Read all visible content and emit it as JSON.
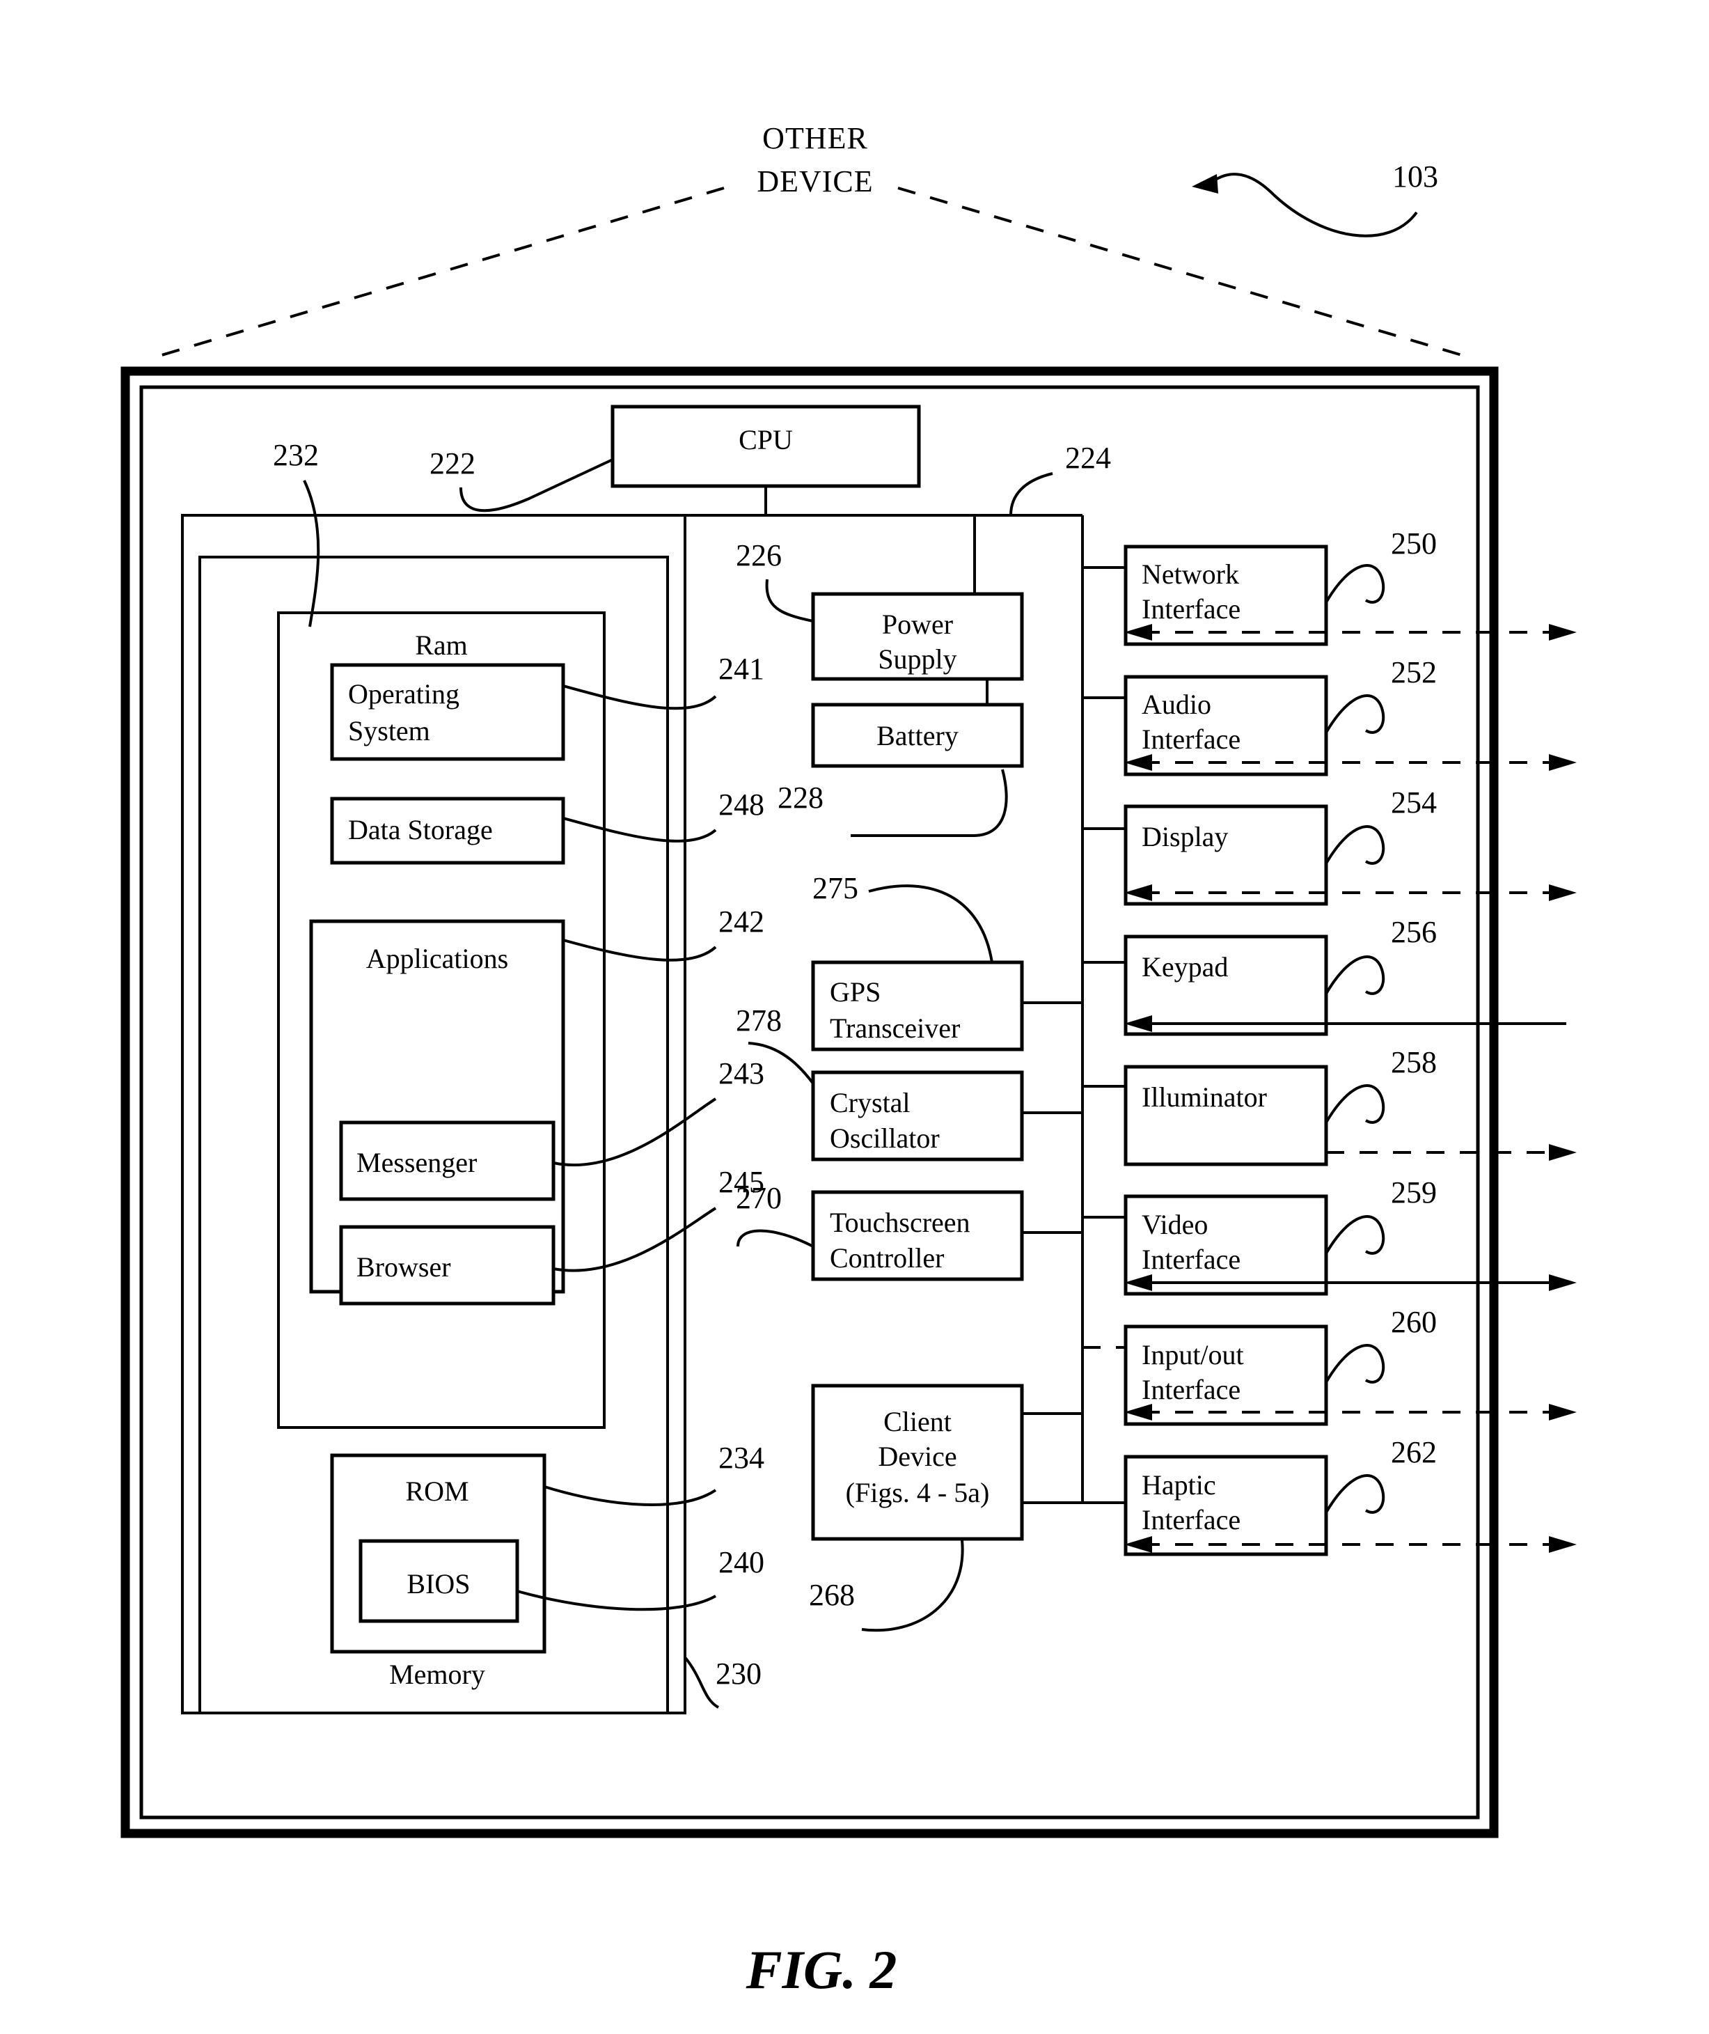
{
  "figure": {
    "caption": "FIG. 2",
    "callout_top": "OTHER DEVICE",
    "callout_top_line1": "OTHER",
    "callout_top_line2": "DEVICE",
    "figure_ref": "103"
  },
  "blocks": {
    "cpu": {
      "label": "CPU",
      "ref": "222"
    },
    "memory": {
      "label": "Memory",
      "ref": "230"
    },
    "memory_inner_ref": "232",
    "ram": {
      "label": "Ram",
      "ref": "234"
    },
    "operating_system": {
      "label_line1": "Operating",
      "label_line2": "System",
      "ref": "241"
    },
    "data_storage": {
      "label": "Data Storage",
      "ref": "248"
    },
    "applications": {
      "label": "Applications",
      "ref": "242"
    },
    "messenger": {
      "label": "Messenger",
      "ref": "243"
    },
    "browser": {
      "label": "Browser",
      "ref": "245"
    },
    "rom": {
      "label": "ROM",
      "ref": "234"
    },
    "bios": {
      "label": "BIOS",
      "ref": "240"
    },
    "power_supply": {
      "label_line1": "Power",
      "label_line2": "Supply",
      "ref": "226"
    },
    "battery": {
      "label": "Battery",
      "ref": "228"
    },
    "gps_transceiver": {
      "label_line1": "GPS",
      "label_line2": "Transceiver",
      "ref": "275"
    },
    "crystal_oscillator": {
      "label_line1": "Crystal",
      "label_line2": "Oscillator",
      "ref": "278"
    },
    "touchscreen_controller": {
      "label_line1": "Touchscreen",
      "label_line2": "Controller",
      "ref": "270"
    },
    "client_device": {
      "label_line1": "Client",
      "label_line2": "Device",
      "label_line3": "(Figs. 4 - 5a)",
      "ref": "268"
    },
    "network_interface": {
      "label_line1": "Network",
      "label_line2": "Interface",
      "ref": "250"
    },
    "audio_interface": {
      "label_line1": "Audio",
      "label_line2": "Interface",
      "ref": "252"
    },
    "display": {
      "label": "Display",
      "ref": "254"
    },
    "keypad": {
      "label": "Keypad",
      "ref": "256"
    },
    "illuminator": {
      "label": "Illuminator",
      "ref": "258"
    },
    "video_interface": {
      "label_line1": "Video",
      "label_line2": "Interface",
      "ref": "259"
    },
    "input_out_interface": {
      "label_line1": "Input/out",
      "label_line2": "Interface",
      "ref": "260"
    },
    "haptic_interface": {
      "label_line1": "Haptic",
      "label_line2": "Interface",
      "ref": "262"
    }
  },
  "bus_ref": "224",
  "reference_numerals": [
    "103",
    "222",
    "224",
    "226",
    "228",
    "230",
    "232",
    "234",
    "240",
    "241",
    "242",
    "243",
    "245",
    "248",
    "250",
    "252",
    "254",
    "256",
    "258",
    "259",
    "260",
    "262",
    "268",
    "270",
    "275",
    "278"
  ]
}
